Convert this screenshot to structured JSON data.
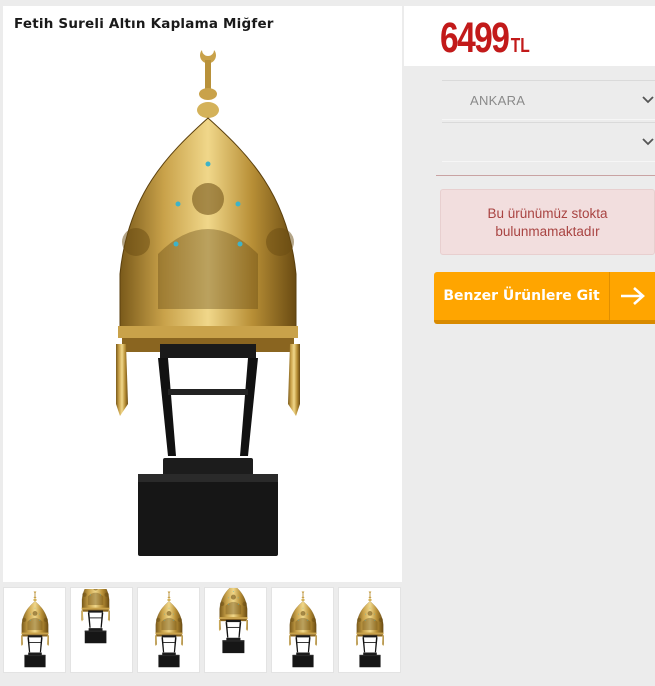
{
  "product": {
    "title": "Fetih Sureli Altın Kaplama Miğfer",
    "price_value": "6499",
    "price_currency": "TL"
  },
  "selects": [
    {
      "value": "ANKARA",
      "icon": "chevron-down-icon"
    },
    {
      "value": "",
      "icon": "chevron-down-icon"
    }
  ],
  "stock": {
    "line1": "Bu ürünümüz stokta",
    "line2": "bulunmamaktadır"
  },
  "cta": {
    "label": "Benzer Ürünlere Git",
    "icon": "arrow-right-icon"
  },
  "thumbnails": [
    {
      "name": "helmet-thumb-front"
    },
    {
      "name": "helmet-thumb-closeup"
    },
    {
      "name": "helmet-thumb-front-2"
    },
    {
      "name": "helmet-thumb-full"
    },
    {
      "name": "helmet-thumb-side"
    },
    {
      "name": "helmet-thumb-side-2"
    }
  ],
  "colors": {
    "price": "#c21a1a",
    "cta": "#ffa500",
    "alert_bg": "#f2dede",
    "alert_text": "#a94442"
  }
}
